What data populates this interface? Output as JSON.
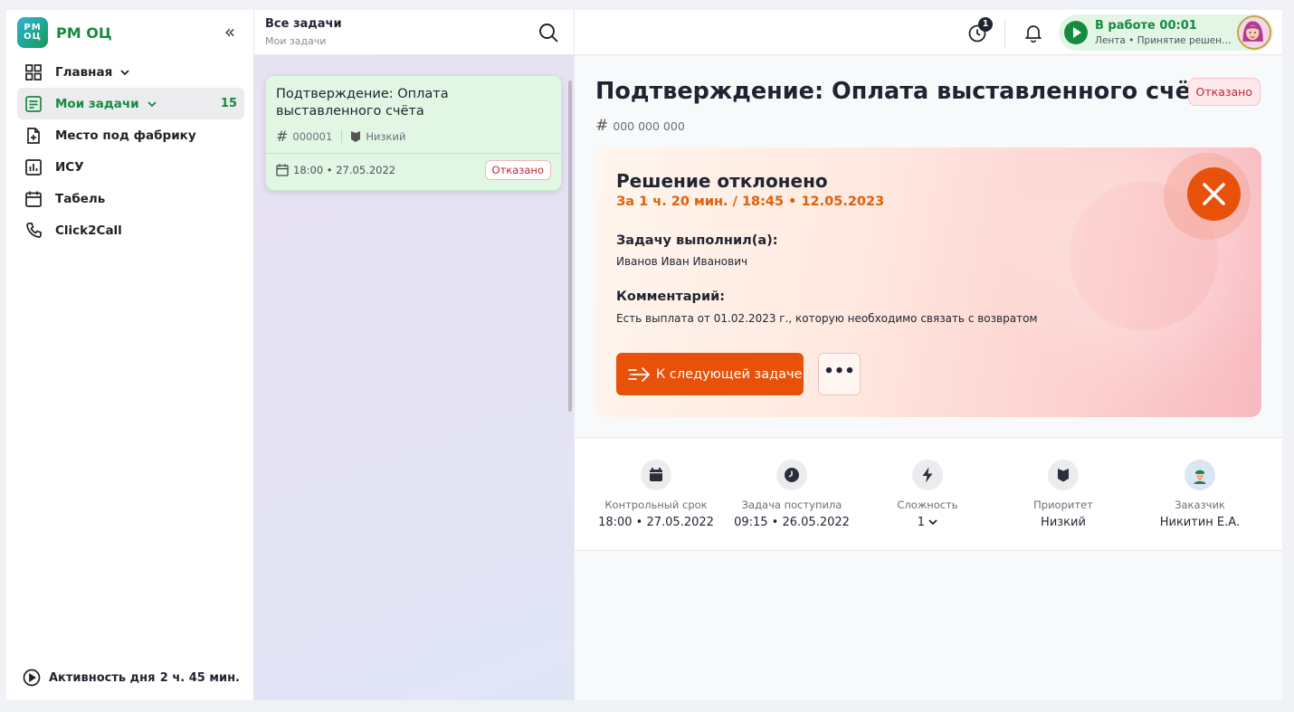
{
  "app": {
    "logo_badge": "РМ ОЦ",
    "logo_text": "РМ ОЦ"
  },
  "sidebar": {
    "items": [
      {
        "label": "Главная",
        "icon": "grid-icon"
      },
      {
        "label": "Мои задачи",
        "icon": "tasks-icon",
        "count": "15",
        "active": true
      },
      {
        "label": "Место под фабрику",
        "icon": "file-plus-icon"
      },
      {
        "label": "ИСУ",
        "icon": "chart-icon"
      },
      {
        "label": "Табель",
        "icon": "calendar-icon"
      },
      {
        "label": "Click2Call",
        "icon": "phone-icon"
      }
    ],
    "activity_label": "Активность дня",
    "activity_value": "2 ч. 45 мин."
  },
  "middle": {
    "title": "Все задачи",
    "subtitle": "Мои задачи",
    "card": {
      "title": "Подтверждение: Оплата выставленного счёта",
      "id": "000001",
      "priority": "Низкий",
      "date": "18:00 • 27.05.2022",
      "status": "Отказано"
    }
  },
  "topbar": {
    "timer_badge": "1",
    "work_title": "В работе 00:01",
    "work_sub": "Лента • Принятие решения по задаче"
  },
  "detail": {
    "title": "Подтверждение: Оплата выставленного счёта",
    "status": "Отказано",
    "id": "000 000 000",
    "decision": {
      "title": "Решение отклонено",
      "time": "За 1 ч. 20 мин. / 18:45 • 12.05.2023",
      "executor_label": "Задачу выполнил(а):",
      "executor": "Иванов Иван Иванович",
      "comment_label": "Комментарий:",
      "comment": "Есть выплата от 01.02.2023 г., которую необходимо связать с возвратом",
      "next_button": "К следующей задаче",
      "more_button": "•••"
    },
    "props": [
      {
        "label": "Контрольный срок",
        "value": "18:00 • 27.05.2022",
        "icon": "calendar-icon"
      },
      {
        "label": "Задача поступила",
        "value": "09:15 • 26.05.2022",
        "icon": "clock-icon"
      },
      {
        "label": "Сложность",
        "value": "1",
        "icon": "lightning-icon"
      },
      {
        "label": "Приоритет",
        "value": "Низкий",
        "icon": "flag-icon"
      },
      {
        "label": "Заказчик",
        "value": "Никитин Е.А.",
        "icon": "customer-avatar"
      }
    ]
  },
  "colors": {
    "brand_green": "#168a3f",
    "accent_orange": "#e8510a",
    "status_red": "#c2243a"
  }
}
